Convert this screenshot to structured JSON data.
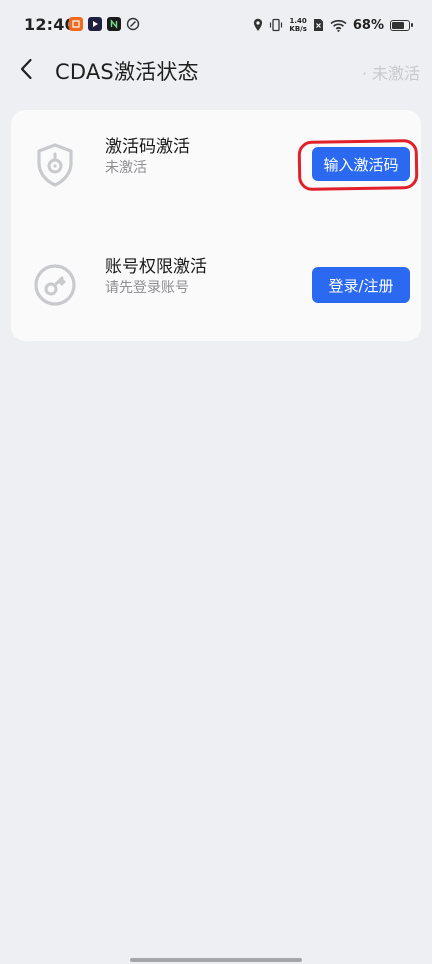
{
  "status_bar": {
    "time": "12:40",
    "net_speed_value": "1.40",
    "net_speed_unit": "KB/s",
    "battery_percent": "68%",
    "battery_level": 0.68
  },
  "header": {
    "title": "CDAS激活状态",
    "status_text": "· 未激活"
  },
  "card": {
    "rows": [
      {
        "title": "激活码激活",
        "subtitle": "未激活",
        "button_label": "输入激活码"
      },
      {
        "title": "账号权限激活",
        "subtitle": "请先登录账号",
        "button_label": "登录/注册"
      }
    ]
  },
  "colors": {
    "accent": "#2b6af0",
    "highlight": "#e0202a",
    "background": "#eeeff3",
    "card": "#fafafa"
  }
}
